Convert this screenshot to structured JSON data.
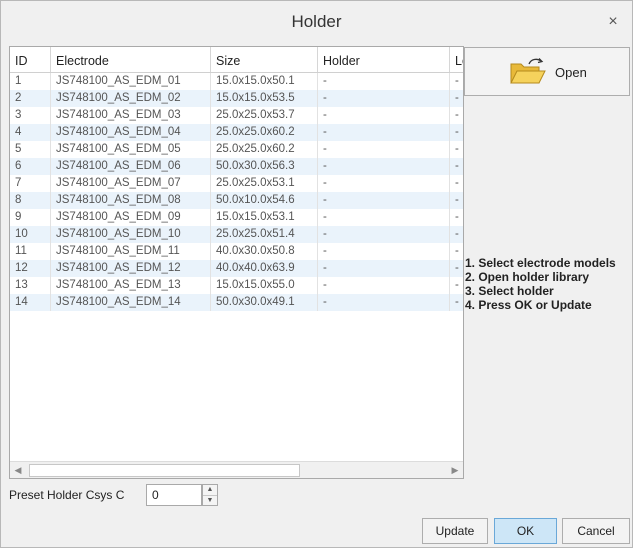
{
  "dialog": {
    "title": "Holder",
    "close_glyph": "×"
  },
  "table": {
    "columns": [
      "ID",
      "Electrode",
      "Size",
      "Holder",
      "Lo"
    ],
    "rows": [
      {
        "id": "1",
        "electrode": "JS748100_AS_EDM_01",
        "size": "15.0x15.0x50.1",
        "holder": "-",
        "lo": "-"
      },
      {
        "id": "2",
        "electrode": "JS748100_AS_EDM_02",
        "size": "15.0x15.0x53.5",
        "holder": "-",
        "lo": "-"
      },
      {
        "id": "3",
        "electrode": "JS748100_AS_EDM_03",
        "size": "25.0x25.0x53.7",
        "holder": "-",
        "lo": "-"
      },
      {
        "id": "4",
        "electrode": "JS748100_AS_EDM_04",
        "size": "25.0x25.0x60.2",
        "holder": "-",
        "lo": "-"
      },
      {
        "id": "5",
        "electrode": "JS748100_AS_EDM_05",
        "size": "25.0x25.0x60.2",
        "holder": "-",
        "lo": "-"
      },
      {
        "id": "6",
        "electrode": "JS748100_AS_EDM_06",
        "size": "50.0x30.0x56.3",
        "holder": "-",
        "lo": "-"
      },
      {
        "id": "7",
        "electrode": "JS748100_AS_EDM_07",
        "size": "25.0x25.0x53.1",
        "holder": "-",
        "lo": "-"
      },
      {
        "id": "8",
        "electrode": "JS748100_AS_EDM_08",
        "size": "50.0x10.0x54.6",
        "holder": "-",
        "lo": "-"
      },
      {
        "id": "9",
        "electrode": "JS748100_AS_EDM_09",
        "size": "15.0x15.0x53.1",
        "holder": "-",
        "lo": "-"
      },
      {
        "id": "10",
        "electrode": "JS748100_AS_EDM_10",
        "size": "25.0x25.0x51.4",
        "holder": "-",
        "lo": "-"
      },
      {
        "id": "11",
        "electrode": "JS748100_AS_EDM_11",
        "size": "40.0x30.0x50.8",
        "holder": "-",
        "lo": "-"
      },
      {
        "id": "12",
        "electrode": "JS748100_AS_EDM_12",
        "size": "40.0x40.0x63.9",
        "holder": "-",
        "lo": "-"
      },
      {
        "id": "13",
        "electrode": "JS748100_AS_EDM_13",
        "size": "15.0x15.0x55.0",
        "holder": "-",
        "lo": "-"
      },
      {
        "id": "14",
        "electrode": "JS748100_AS_EDM_14",
        "size": "50.0x30.0x49.1",
        "holder": "-",
        "lo": "-"
      }
    ],
    "scroll_left_glyph": "◀",
    "scroll_right_glyph": "▶"
  },
  "open_button": {
    "label": "Open",
    "icon": "folder-open-icon"
  },
  "instructions": [
    "1. Select electrode models",
    "2. Open holder library",
    "3. Select holder",
    "4. Press OK or Update"
  ],
  "preset": {
    "label": "Preset Holder Csys C",
    "value": "0",
    "up_glyph": "▲",
    "down_glyph": "▼"
  },
  "buttons": {
    "update": "Update",
    "ok": "OK",
    "cancel": "Cancel"
  },
  "colors": {
    "row_alt": "#eaf3fb",
    "ok_accent": "#cde6f7",
    "folder": "#f5d25c"
  }
}
